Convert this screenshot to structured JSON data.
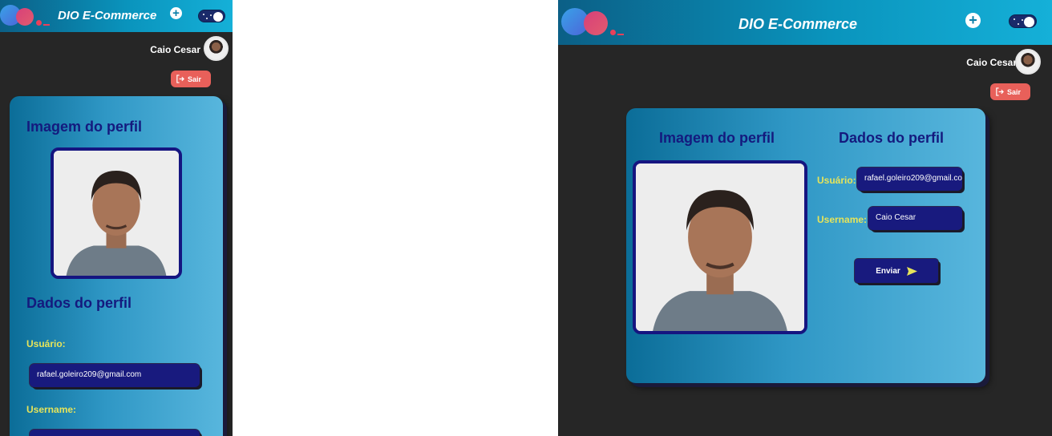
{
  "app": {
    "title": "DIO E-Commerce"
  },
  "user": {
    "name": "Caio Cesar"
  },
  "logout": {
    "label": "Sair"
  },
  "profile": {
    "image_section_title": "Imagem do perfil",
    "data_section_title": "Dados do perfil",
    "usuario_label": "Usuário:",
    "usuario_value": "rafael.goleiro209@gmail.com",
    "username_label": "Username:",
    "username_value": "Caio Cesar",
    "submit_label": "Enviar"
  },
  "theme": {
    "header_gradient": [
      "#0b5f86",
      "#15b0d8"
    ],
    "background": "#262626",
    "card_accent": "#181a7e",
    "label_color": "#e6e45a",
    "logout_color": "#e8605a"
  },
  "icons": {
    "add": "plus-circle-icon",
    "theme": "dark-mode-toggle",
    "logout": "logout-icon",
    "send": "send-icon"
  }
}
